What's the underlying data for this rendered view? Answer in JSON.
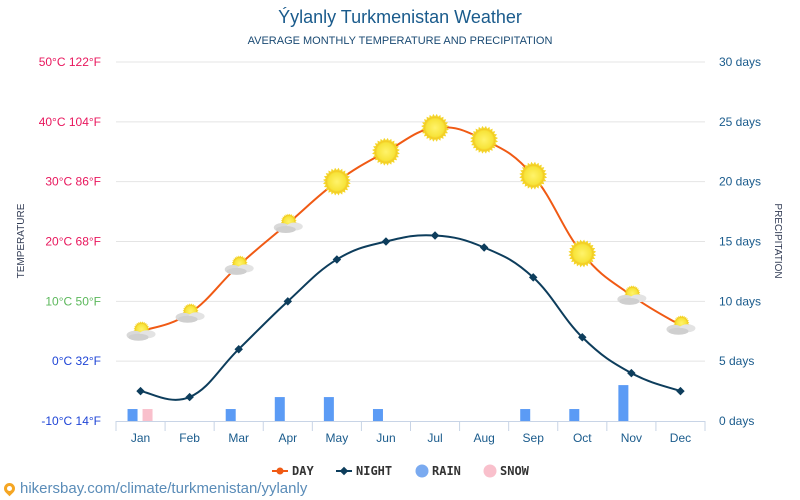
{
  "header": {
    "title": "Ýylanly Turkmenistan Weather",
    "subtitle": "AVERAGE MONTHLY TEMPERATURE AND PRECIPITATION"
  },
  "footer": {
    "url": "hikersbay.com/climate/turkmenistan/yylanly",
    "icon": "location-pin-icon"
  },
  "colors": {
    "day": "#f05a14",
    "night": "#0d3d5c",
    "rain": "#5b9bf5",
    "snow": "#f9c0cc",
    "title": "#1a5b8c"
  },
  "chart_data": {
    "type": "line",
    "title": "Ýylanly Turkmenistan Weather",
    "subtitle": "AVERAGE MONTHLY TEMPERATURE AND PRECIPITATION",
    "categories": [
      "Jan",
      "Feb",
      "Mar",
      "Apr",
      "May",
      "Jun",
      "Jul",
      "Aug",
      "Sep",
      "Oct",
      "Nov",
      "Dec"
    ],
    "ylabel": "TEMPERATURE",
    "y2label": "PRECIPITATION",
    "ylim": [
      -10,
      50
    ],
    "y2lim": [
      0,
      30
    ],
    "grid": true,
    "legend_position": "bottom",
    "y_ticks": [
      {
        "value": 50,
        "label": "50°C 122°F",
        "color": "#e8175d"
      },
      {
        "value": 40,
        "label": "40°C 104°F",
        "color": "#e8175d"
      },
      {
        "value": 30,
        "label": "30°C 86°F",
        "color": "#e8175d"
      },
      {
        "value": 20,
        "label": "20°C 68°F",
        "color": "#e8175d"
      },
      {
        "value": 10,
        "label": "10°C 50°F",
        "color": "#5cb85c"
      },
      {
        "value": 0,
        "label": "0°C 32°F",
        "color": "#1f45d6"
      },
      {
        "value": -10,
        "label": "-10°C 14°F",
        "color": "#1f45d6"
      }
    ],
    "y2_ticks": [
      {
        "value": 30,
        "label": "30 days"
      },
      {
        "value": 25,
        "label": "25 days"
      },
      {
        "value": 20,
        "label": "20 days"
      },
      {
        "value": 15,
        "label": "15 days"
      },
      {
        "value": 10,
        "label": "10 days"
      },
      {
        "value": 5,
        "label": "5 days"
      },
      {
        "value": 0,
        "label": "0 days"
      }
    ],
    "series": [
      {
        "name": "DAY",
        "type": "line",
        "axis": "temperature",
        "values": [
          5,
          8,
          16,
          23,
          30,
          35,
          39,
          37,
          31,
          18,
          11,
          6
        ],
        "icons": [
          "partly-cloudy",
          "partly-cloudy",
          "partly-cloudy",
          "partly-cloudy",
          "sunny",
          "sunny",
          "sunny",
          "sunny",
          "sunny",
          "sunny",
          "partly-cloudy",
          "partly-cloudy"
        ]
      },
      {
        "name": "NIGHT",
        "type": "line",
        "axis": "temperature",
        "values": [
          -5,
          -6,
          2,
          10,
          17,
          20,
          21,
          19,
          14,
          4,
          -2,
          -5
        ]
      },
      {
        "name": "RAIN",
        "type": "bar",
        "axis": "precipitation",
        "values": [
          1,
          0,
          1,
          2,
          2,
          1,
          0,
          0,
          1,
          1,
          3,
          0
        ]
      },
      {
        "name": "SNOW",
        "type": "bar",
        "axis": "precipitation",
        "values": [
          1,
          0,
          0,
          0,
          0,
          0,
          0,
          0,
          0,
          0,
          0,
          0
        ]
      }
    ],
    "legend": [
      "DAY",
      "NIGHT",
      "RAIN",
      "SNOW"
    ]
  }
}
